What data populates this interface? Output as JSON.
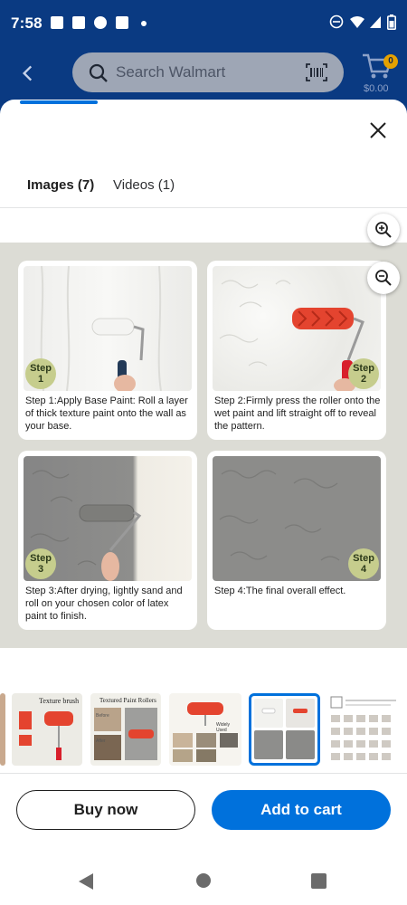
{
  "status_bar": {
    "time": "7:58"
  },
  "header": {
    "search_placeholder": "Search Walmart",
    "cart_count": "0",
    "cart_total": "$0.00"
  },
  "tabs": [
    {
      "label": "Images (7)",
      "active": true
    },
    {
      "label": "Videos (1)",
      "active": false
    }
  ],
  "main_image": {
    "steps": [
      {
        "badge_word": "Step",
        "badge_num": "1",
        "caption": "Step 1:Apply Base Paint: Roll a layer of thick texture paint onto the wall as your base."
      },
      {
        "badge_word": "Step",
        "badge_num": "2",
        "caption": "Step 2:Firmly press the roller onto the wet paint and lift straight off to reveal the pattern."
      },
      {
        "badge_word": "Step",
        "badge_num": "3",
        "caption": "Step 3:After drying, lightly sand and roll on your chosen color of latex paint to finish."
      },
      {
        "badge_word": "Step",
        "badge_num": "4",
        "caption": "Step 4:The final overall effect."
      }
    ]
  },
  "thumbnails": [
    {
      "caption": "Texture brush"
    },
    {
      "caption": "Textured Paint Rollers",
      "sub_before": "Before",
      "sub_after": "After"
    },
    {
      "caption": "Widely Used"
    },
    {
      "caption": ""
    },
    {
      "caption": ""
    }
  ],
  "actions": {
    "buy_now": "Buy now",
    "add_to_cart": "Add to cart"
  },
  "colors": {
    "header_bg": "#0a3a82",
    "accent": "#0071dc",
    "step_badge": "#c6cd8d"
  }
}
